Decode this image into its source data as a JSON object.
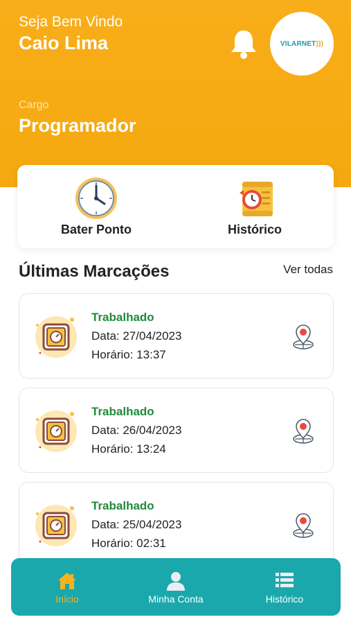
{
  "header": {
    "welcome": "Seja Bem Vindo",
    "user_name": "Caio Lima",
    "role_label": "Cargo",
    "role_value": "Programador",
    "logo": {
      "text_main": "VILARNET",
      "accent": "#1b9aa8"
    },
    "bell_icon": "bell-icon"
  },
  "actions": [
    {
      "label": "Bater Ponto",
      "icon": "clock-icon"
    },
    {
      "label": "Histórico",
      "icon": "history-scroll-icon"
    }
  ],
  "recent": {
    "title": "Últimas Marcações",
    "see_all": "Ver todas",
    "entries": [
      {
        "status": "Trabalhado",
        "date": "Data: 27/04/2023",
        "time": "Horário: 13:37"
      },
      {
        "status": "Trabalhado",
        "date": "Data: 26/04/2023",
        "time": "Horário: 13:24"
      },
      {
        "status": "Trabalhado",
        "date": "Data: 25/04/2023",
        "time": "Horário: 02:31"
      }
    ]
  },
  "bottom_nav": {
    "items": [
      {
        "label": "Início",
        "icon": "home-icon",
        "active": true
      },
      {
        "label": "Minha Conta",
        "icon": "user-icon",
        "active": false
      },
      {
        "label": "Histórico",
        "icon": "list-icon",
        "active": false
      }
    ]
  },
  "colors": {
    "header": "#f8ae1a",
    "nav_bg": "#1aa8ad",
    "nav_active": "#f8b21d",
    "status_green": "#1f8a3b"
  }
}
